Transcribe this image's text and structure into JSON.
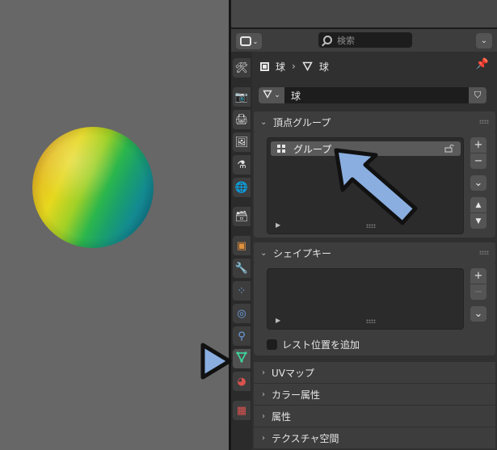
{
  "search": {
    "placeholder": "検索"
  },
  "breadcrumb": {
    "object_name": "球",
    "mesh_name": "球"
  },
  "datablock": {
    "name": "球"
  },
  "vertex_groups": {
    "title": "頂点グループ",
    "items": [
      {
        "name": "グループ"
      }
    ],
    "buttons": {
      "add": "+",
      "remove": "−",
      "menu": "⌄",
      "up": "▲",
      "down": "▼"
    }
  },
  "shape_keys": {
    "title": "シェイプキー",
    "relative_label": "レスト位置を追加",
    "buttons": {
      "add": "+",
      "remove": "−",
      "menu": "⌄"
    }
  },
  "collapsed_panels": [
    {
      "label": "UVマップ"
    },
    {
      "label": "カラー属性"
    },
    {
      "label": "属性"
    },
    {
      "label": "テクスチャ空間"
    }
  ],
  "tabs": [
    {
      "icon": "tool-icon"
    },
    {
      "icon": "render-icon"
    },
    {
      "icon": "output-icon"
    },
    {
      "icon": "view-layer-icon"
    },
    {
      "icon": "scene-icon"
    },
    {
      "icon": "world-icon"
    },
    {
      "icon": "collection-icon"
    },
    {
      "icon": "object-icon"
    },
    {
      "icon": "modifier-icon"
    },
    {
      "icon": "particles-icon"
    },
    {
      "icon": "physics-icon"
    },
    {
      "icon": "constraints-icon"
    },
    {
      "icon": "mesh-data-icon",
      "active": true
    },
    {
      "icon": "material-icon"
    },
    {
      "icon": "texture-icon"
    }
  ],
  "colors": {
    "annotation_fill": "#8aaee0",
    "annotation_stroke": "#111111",
    "mesh_data_green": "#3fd29a"
  }
}
